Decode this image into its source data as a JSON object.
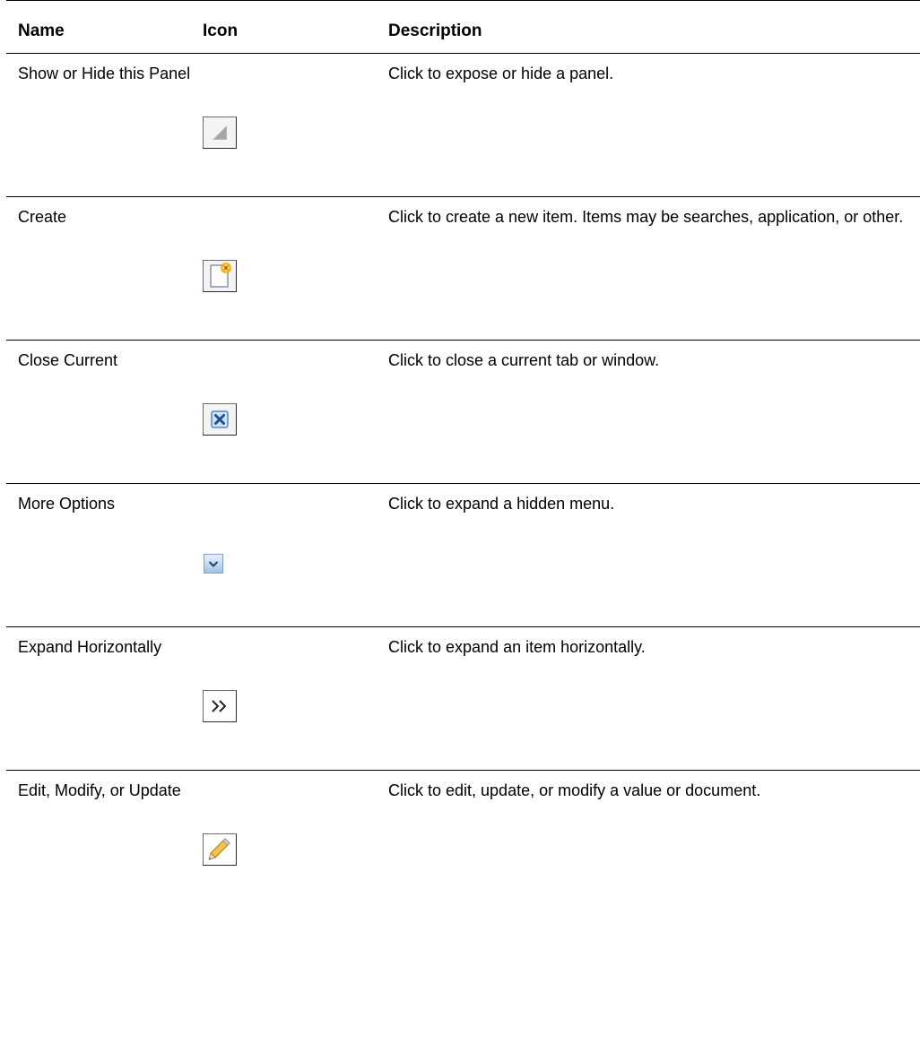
{
  "table": {
    "headers": {
      "name": "Name",
      "icon": "Icon",
      "description": "Description"
    },
    "rows": [
      {
        "name": "Show or Hide this Panel",
        "icon": "show-hide-panel-icon",
        "description": "Click to expose or hide a panel."
      },
      {
        "name": "Create",
        "icon": "create-icon",
        "description": "Click to create a new item. Items may be searches, application, or other."
      },
      {
        "name": "Close Current",
        "icon": "close-icon",
        "description": "Click to close a current tab or window."
      },
      {
        "name": "More Options",
        "icon": "more-options-icon",
        "description": "Click to expand a hidden menu."
      },
      {
        "name": "Expand Horizontally",
        "icon": "expand-horizontally-icon",
        "description": "Click to expand an item horizontally."
      },
      {
        "name": "Edit, Modify, or Update",
        "icon": "edit-icon",
        "description": "Click to edit, update, or modify a value or document."
      }
    ]
  }
}
